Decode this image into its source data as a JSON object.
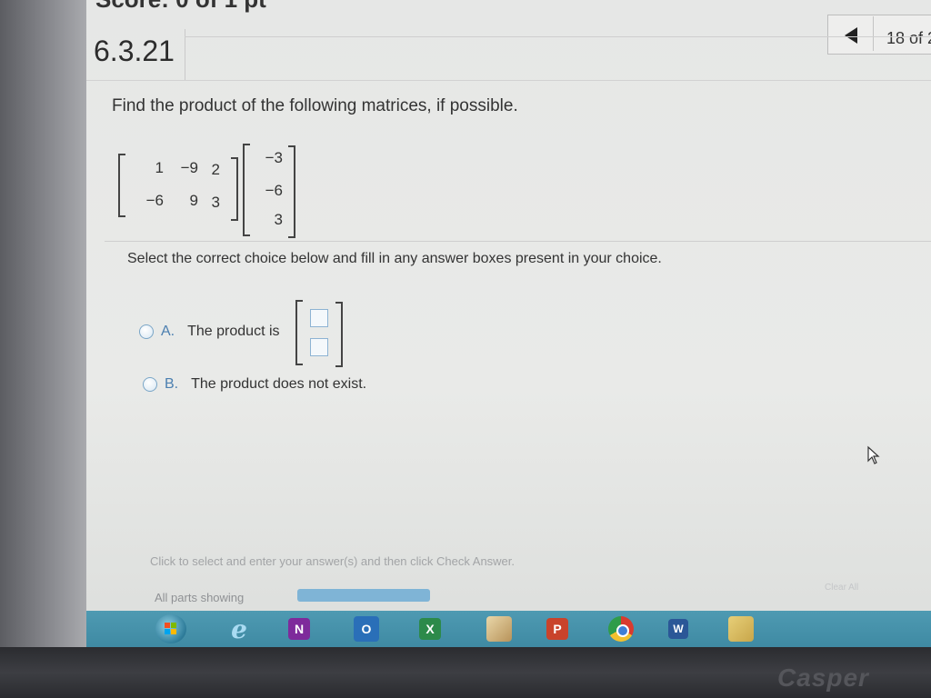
{
  "header": {
    "score_text": "Score: 0 of 1 pt",
    "question_number": "6.3.21",
    "page_indicator": "18 of 2"
  },
  "question": {
    "prompt": "Find the product of the following matrices, if possible.",
    "matrix_a": [
      [
        "1",
        "−9",
        "2"
      ],
      [
        "−6",
        "9",
        "3"
      ]
    ],
    "matrix_b": [
      [
        "−3"
      ],
      [
        "−6"
      ],
      [
        "3"
      ]
    ],
    "instruction": "Select the correct choice below and fill in any answer boxes present in your choice."
  },
  "choices": [
    {
      "letter": "A.",
      "text": "The product is"
    },
    {
      "letter": "B.",
      "text": "The product does not exist."
    }
  ],
  "answer_boxes": [
    "",
    ""
  ],
  "footer": {
    "hint": "Click to select and enter your answer(s) and then click Check Answer.",
    "parts": "All parts showing",
    "clear_all": "Clear All"
  },
  "taskbar": {
    "apps": [
      "start",
      "internet-explorer",
      "onenote",
      "outlook",
      "excel",
      "photos",
      "powerpoint",
      "chrome",
      "word",
      "file-explorer"
    ]
  },
  "monitor": {
    "brand": "Casper"
  }
}
